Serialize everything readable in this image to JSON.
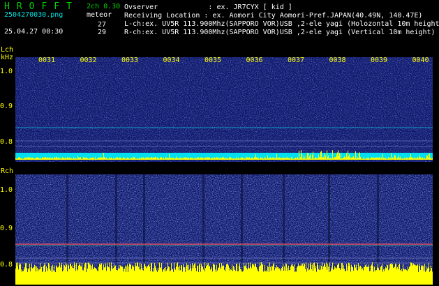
{
  "header": {
    "brand": "HROFFT",
    "filename": "2504270030.png",
    "timestamp": "25.04.27 00:30",
    "mode": "2ch 0.30",
    "meteor_label": "meteor",
    "count_l": "27",
    "count_r": "29",
    "observer": "Ovserver            : ex. JR7CYX [ kid ]",
    "location": "Receiving Location : ex. Aomori City Aomori-Pref.JAPAN(40.49N, 140.47E)",
    "lch_line": "L-ch:ex. UV5R 113.900Mhz(SAPPORO VOR)USB ,2-ele yagi (Holozontal 10m height",
    "rch_line": "R-ch:ex. UV5R 113.900Mhz(SAPPORO VOR)USB ,2-ele yagi (Vertical 10m height)"
  },
  "panels": {
    "lch": {
      "label": "Lch",
      "unit": "kHz",
      "yticks": [
        "1.0",
        "0.9",
        "0.8"
      ]
    },
    "rch": {
      "label": "Rch",
      "yticks": [
        "1.0",
        "0.9",
        "0.8"
      ]
    }
  },
  "time_ticks": [
    "0031",
    "0032",
    "0033",
    "0034",
    "0035",
    "0036",
    "0037",
    "0038",
    "0039",
    "0040"
  ],
  "colors": {
    "background": "#000000",
    "spectrum": "#10186a",
    "noise": "#3050d0",
    "trace": "#00ffff",
    "level": "#ffff00",
    "label": "#ffff00",
    "header_green": "#00d000",
    "header_cyan": "#00e0e0"
  }
}
